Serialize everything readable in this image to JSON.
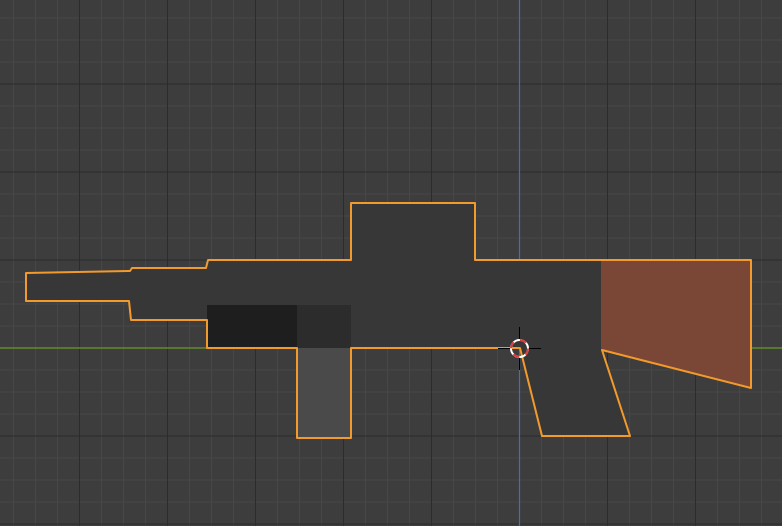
{
  "viewport": {
    "background_color": "#3d3d3d",
    "grid": true,
    "grid_minor_color": "#474747",
    "grid_major_color": "#2c2c2c",
    "x_axis_color": "#6a9a2a",
    "y_axis_color": "#3f6fb8"
  },
  "object": {
    "selected": true,
    "outline_color": "#f39a2c",
    "body_color": "#373737",
    "parts": [
      {
        "id": "body",
        "color": "#373737"
      },
      {
        "id": "stock",
        "color": "#7a4636"
      },
      {
        "id": "handguard",
        "color": "#1e1e1e"
      },
      {
        "id": "magazine-well",
        "color": "#2c2c2c"
      },
      {
        "id": "magazine",
        "color": "#4a4a4a"
      }
    ]
  },
  "cursor_3d": {
    "visible": true,
    "ring_color_a": "#e03c3c",
    "ring_color_b": "#ffffff",
    "crosshair_color": "#000000"
  }
}
